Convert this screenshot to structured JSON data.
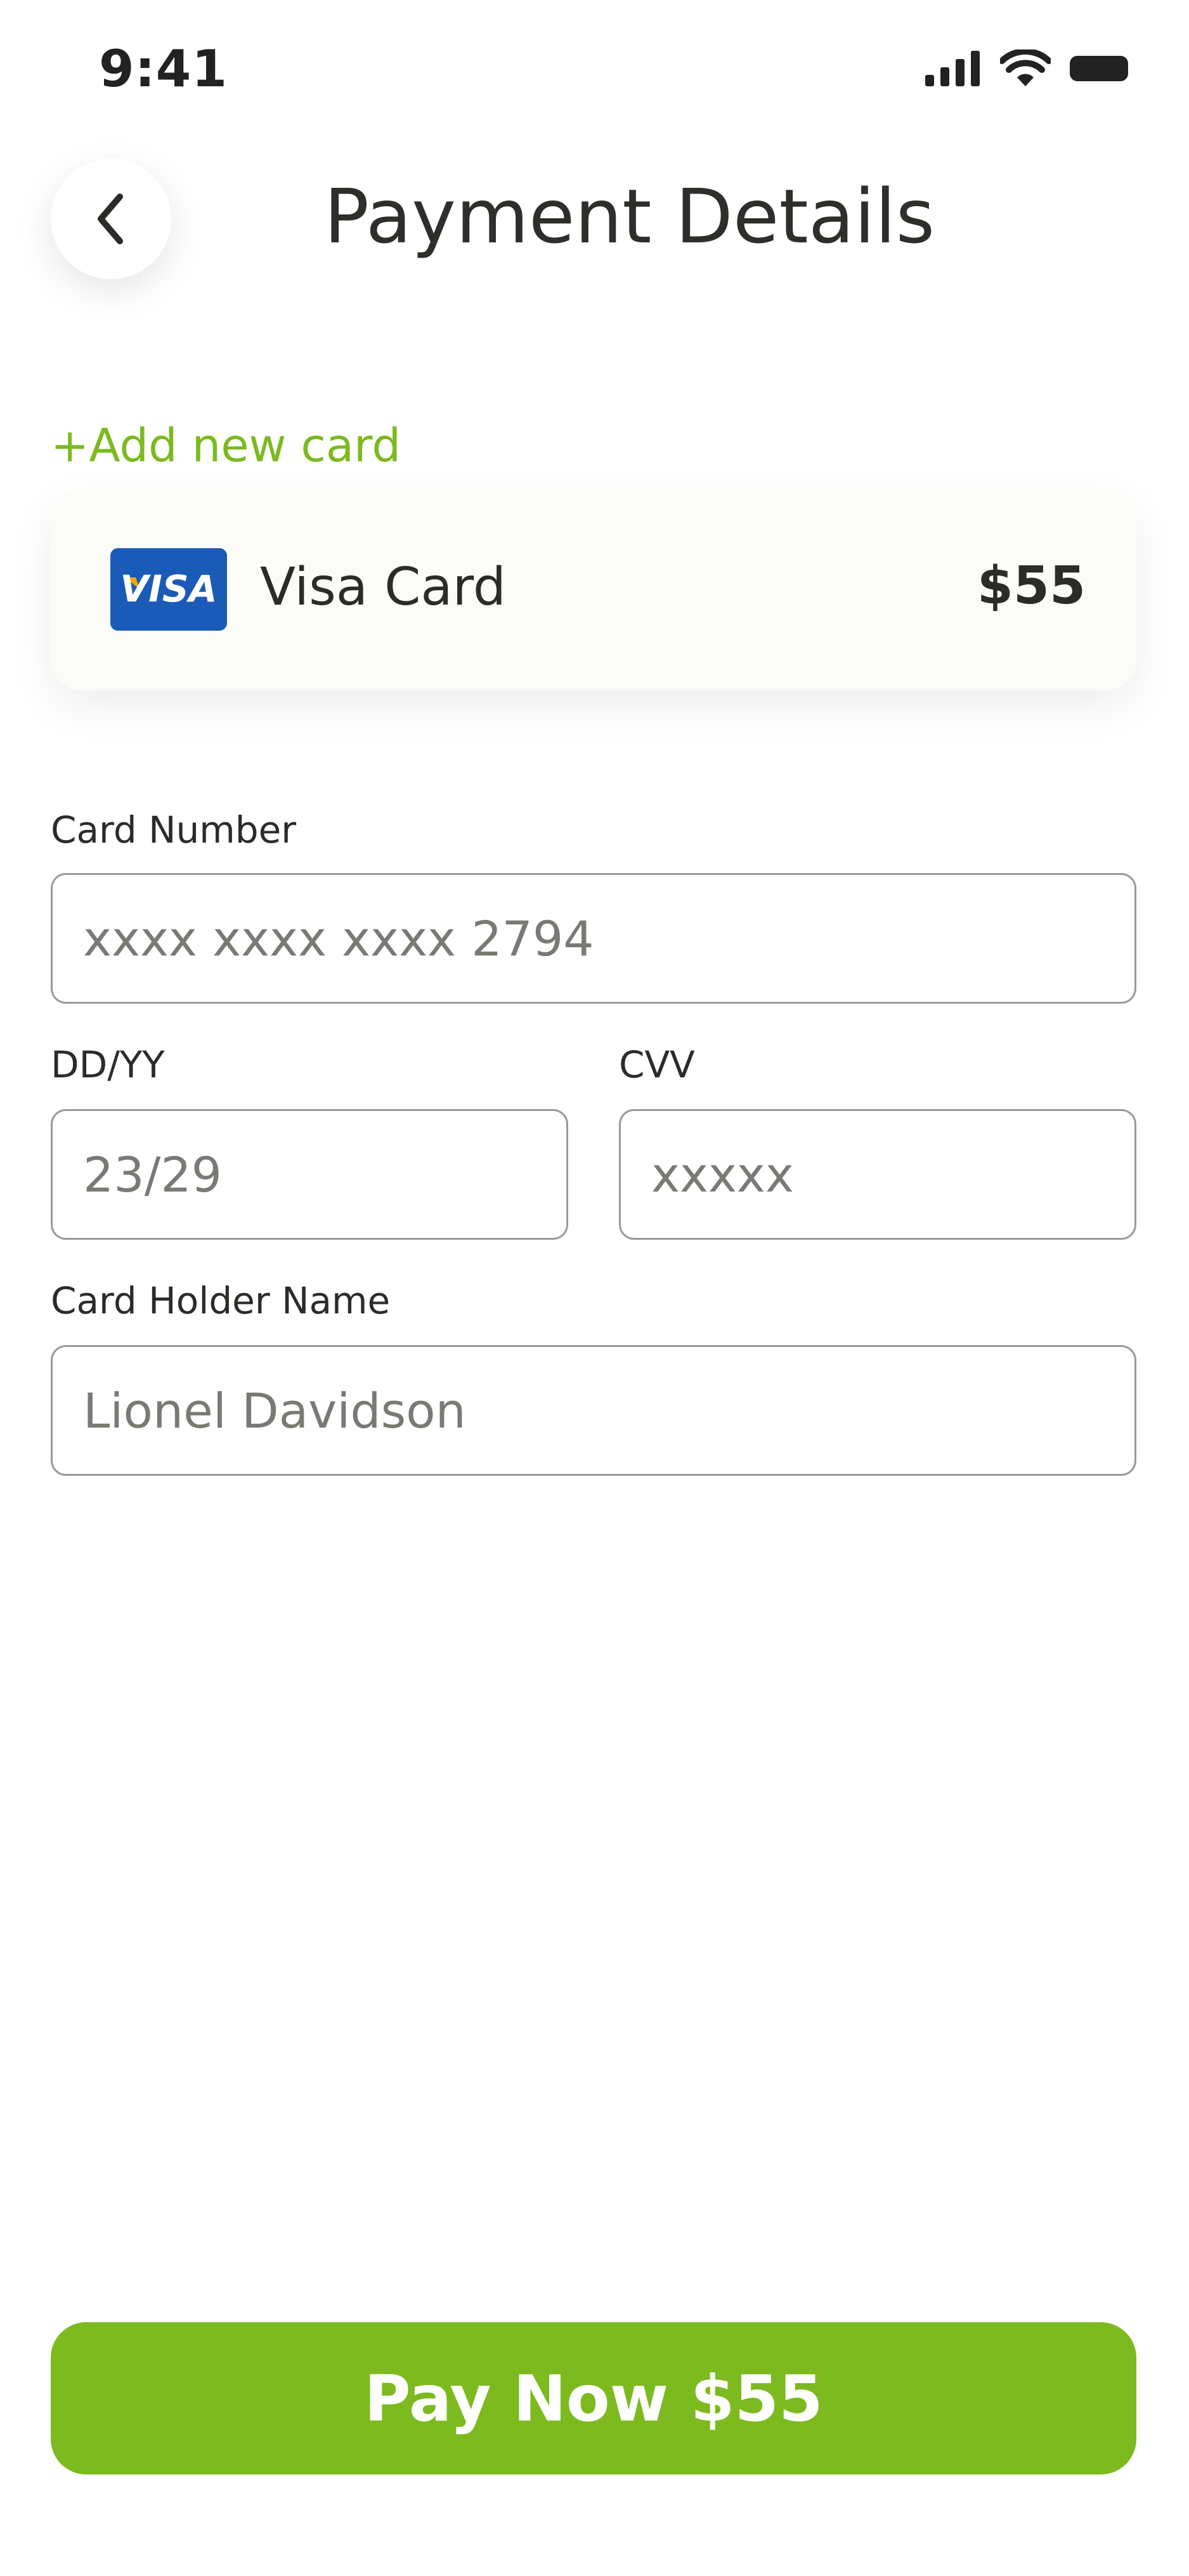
{
  "status_bar": {
    "time": "9:41",
    "icons": [
      "cellular-signal-icon",
      "wifi-icon",
      "battery-icon"
    ]
  },
  "header": {
    "back_icon": "chevron-left-icon",
    "title": "Payment Details"
  },
  "add_card": {
    "label": "+Add new card"
  },
  "selected_card": {
    "brand_logo_text": "VISA",
    "name": "Visa Card",
    "amount": "$55"
  },
  "form": {
    "card_number": {
      "label": "Card Number",
      "placeholder": "xxxx xxxx xxxx 2794"
    },
    "expiry": {
      "label": "DD/YY",
      "placeholder": "23/29"
    },
    "cvv": {
      "label": "CVV",
      "placeholder": "xxxxx"
    },
    "holder_name": {
      "label": "Card Holder Name",
      "placeholder": "Lionel Davidson"
    }
  },
  "pay_button": {
    "label": "Pay Now $55"
  },
  "colors": {
    "accent": "#7CBA1F",
    "visa_blue": "#1A5BB8",
    "visa_gold": "#F2A900",
    "text": "#2B2B28"
  }
}
